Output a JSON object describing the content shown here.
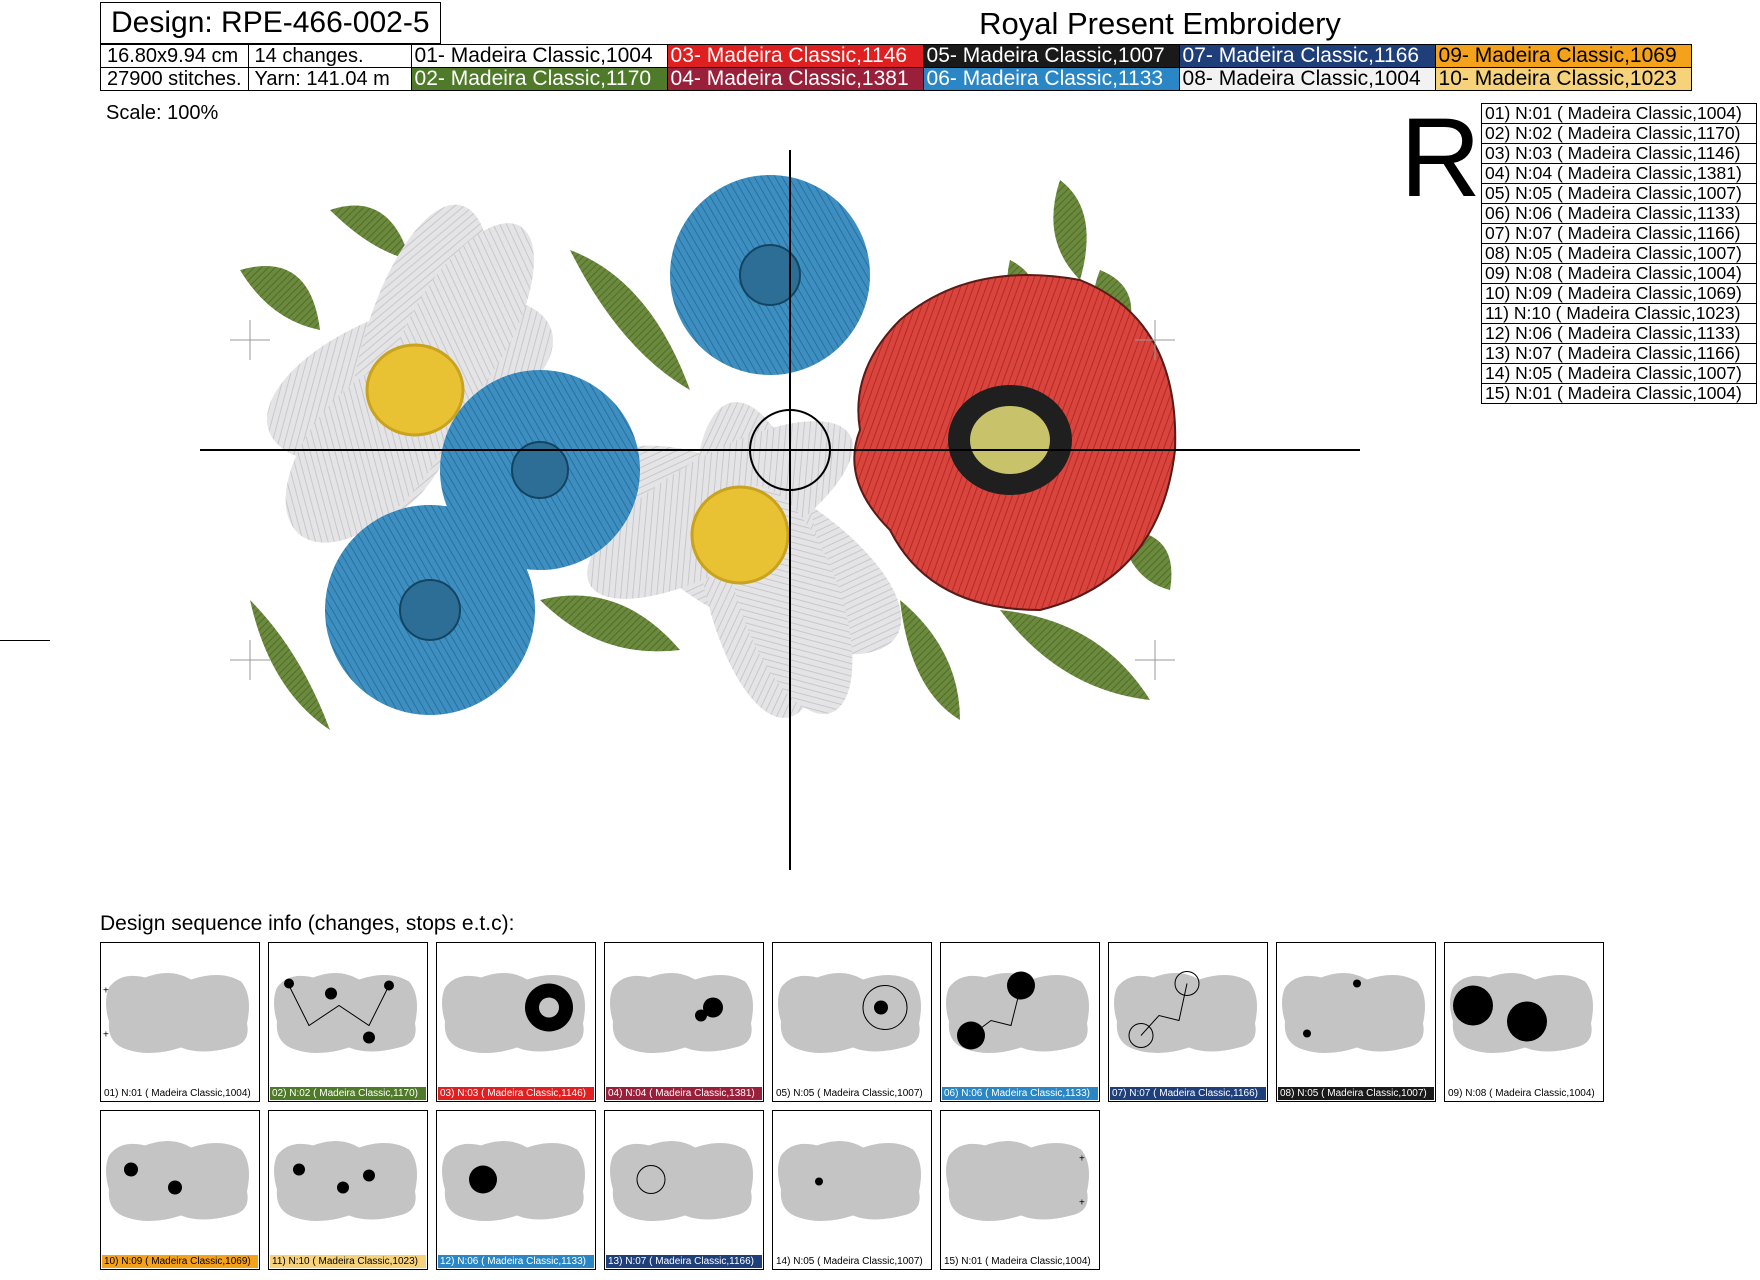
{
  "header": {
    "design": "Design: RPE-466-002-5",
    "brand": "Royal Present Embroidery",
    "size": "16.80x9.94 cm",
    "changes": "14 changes.",
    "stitches": "27900 stitches.",
    "yarn": "Yarn: 141.04 m",
    "scale": "Scale: 100%"
  },
  "colors_row1": [
    {
      "label": "01- Madeira Classic,1004",
      "bg": "#ffffff",
      "fg": "#000000"
    },
    {
      "label": "03- Madeira Classic,1146",
      "bg": "#e02020",
      "fg": "#ffffff"
    },
    {
      "label": "05- Madeira Classic,1007",
      "bg": "#1a1a1a",
      "fg": "#ffffff"
    },
    {
      "label": "07- Madeira Classic,1166",
      "bg": "#1f3f7a",
      "fg": "#ffffff"
    },
    {
      "label": "09- Madeira Classic,1069",
      "bg": "#f4a21a",
      "fg": "#000000"
    }
  ],
  "colors_row2": [
    {
      "label": "02- Madeira Classic,1170",
      "bg": "#4f7a2a",
      "fg": "#ffffff"
    },
    {
      "label": "04- Madeira Classic,1381",
      "bg": "#9a1f3a",
      "fg": "#ffffff"
    },
    {
      "label": "06- Madeira Classic,1133",
      "bg": "#2a86c4",
      "fg": "#ffffff"
    },
    {
      "label": "08- Madeira Classic,1004",
      "bg": "#f2f2f2",
      "fg": "#000000"
    },
    {
      "label": "10- Madeira Classic,1023",
      "bg": "#f6d27a",
      "fg": "#000000"
    }
  ],
  "big_letter": "R",
  "needles": [
    "01) N:01 ( Madeira Classic,1004)",
    "02) N:02 ( Madeira Classic,1170)",
    "03) N:03 ( Madeira Classic,1146)",
    "04) N:04 ( Madeira Classic,1381)",
    "05) N:05 ( Madeira Classic,1007)",
    "06) N:06 ( Madeira Classic,1133)",
    "07) N:07 ( Madeira Classic,1166)",
    "08) N:05 ( Madeira Classic,1007)",
    "09) N:08 ( Madeira Classic,1004)",
    "10) N:09 ( Madeira Classic,1069)",
    "11) N:10 ( Madeira Classic,1023)",
    "12) N:06 ( Madeira Classic,1133)",
    "13) N:07 ( Madeira Classic,1166)",
    "14) N:05 ( Madeira Classic,1007)",
    "15) N:01 ( Madeira Classic,1004)"
  ],
  "sequence_label": "Design sequence info (changes, stops e.t.c):",
  "thumbnails": [
    {
      "label": "01) N:01 ( Madeira Classic,1004)",
      "bg": "#ffffff",
      "fg": "#000000"
    },
    {
      "label": "02) N:02 ( Madeira Classic,1170)",
      "bg": "#4f7a2a",
      "fg": "#ffffff"
    },
    {
      "label": "03) N:03 ( Madeira Classic,1146)",
      "bg": "#e02020",
      "fg": "#ffffff"
    },
    {
      "label": "04) N:04 ( Madeira Classic,1381)",
      "bg": "#9a1f3a",
      "fg": "#ffffff"
    },
    {
      "label": "05) N:05 ( Madeira Classic,1007)",
      "bg": "#ffffff",
      "fg": "#000000"
    },
    {
      "label": "06) N:06 ( Madeira Classic,1133)",
      "bg": "#2a86c4",
      "fg": "#ffffff"
    },
    {
      "label": "07) N:07 ( Madeira Classic,1166)",
      "bg": "#1f3f7a",
      "fg": "#ffffff"
    },
    {
      "label": "08) N:05 ( Madeira Classic,1007)",
      "bg": "#1a1a1a",
      "fg": "#ffffff"
    },
    {
      "label": "09) N:08 ( Madeira Classic,1004)",
      "bg": "#ffffff",
      "fg": "#000000"
    },
    {
      "label": "10) N:09 ( Madeira Classic,1069)",
      "bg": "#f4a21a",
      "fg": "#000000"
    },
    {
      "label": "11) N:10 ( Madeira Classic,1023)",
      "bg": "#f6d27a",
      "fg": "#000000"
    },
    {
      "label": "12) N:06 ( Madeira Classic,1133)",
      "bg": "#2a86c4",
      "fg": "#ffffff"
    },
    {
      "label": "13) N:07 ( Madeira Classic,1166)",
      "bg": "#1f3f7a",
      "fg": "#ffffff"
    },
    {
      "label": "14) N:05 ( Madeira Classic,1007)",
      "bg": "#ffffff",
      "fg": "#000000"
    },
    {
      "label": "15) N:01 ( Madeira Classic,1004)",
      "bg": "#ffffff",
      "fg": "#000000"
    }
  ]
}
